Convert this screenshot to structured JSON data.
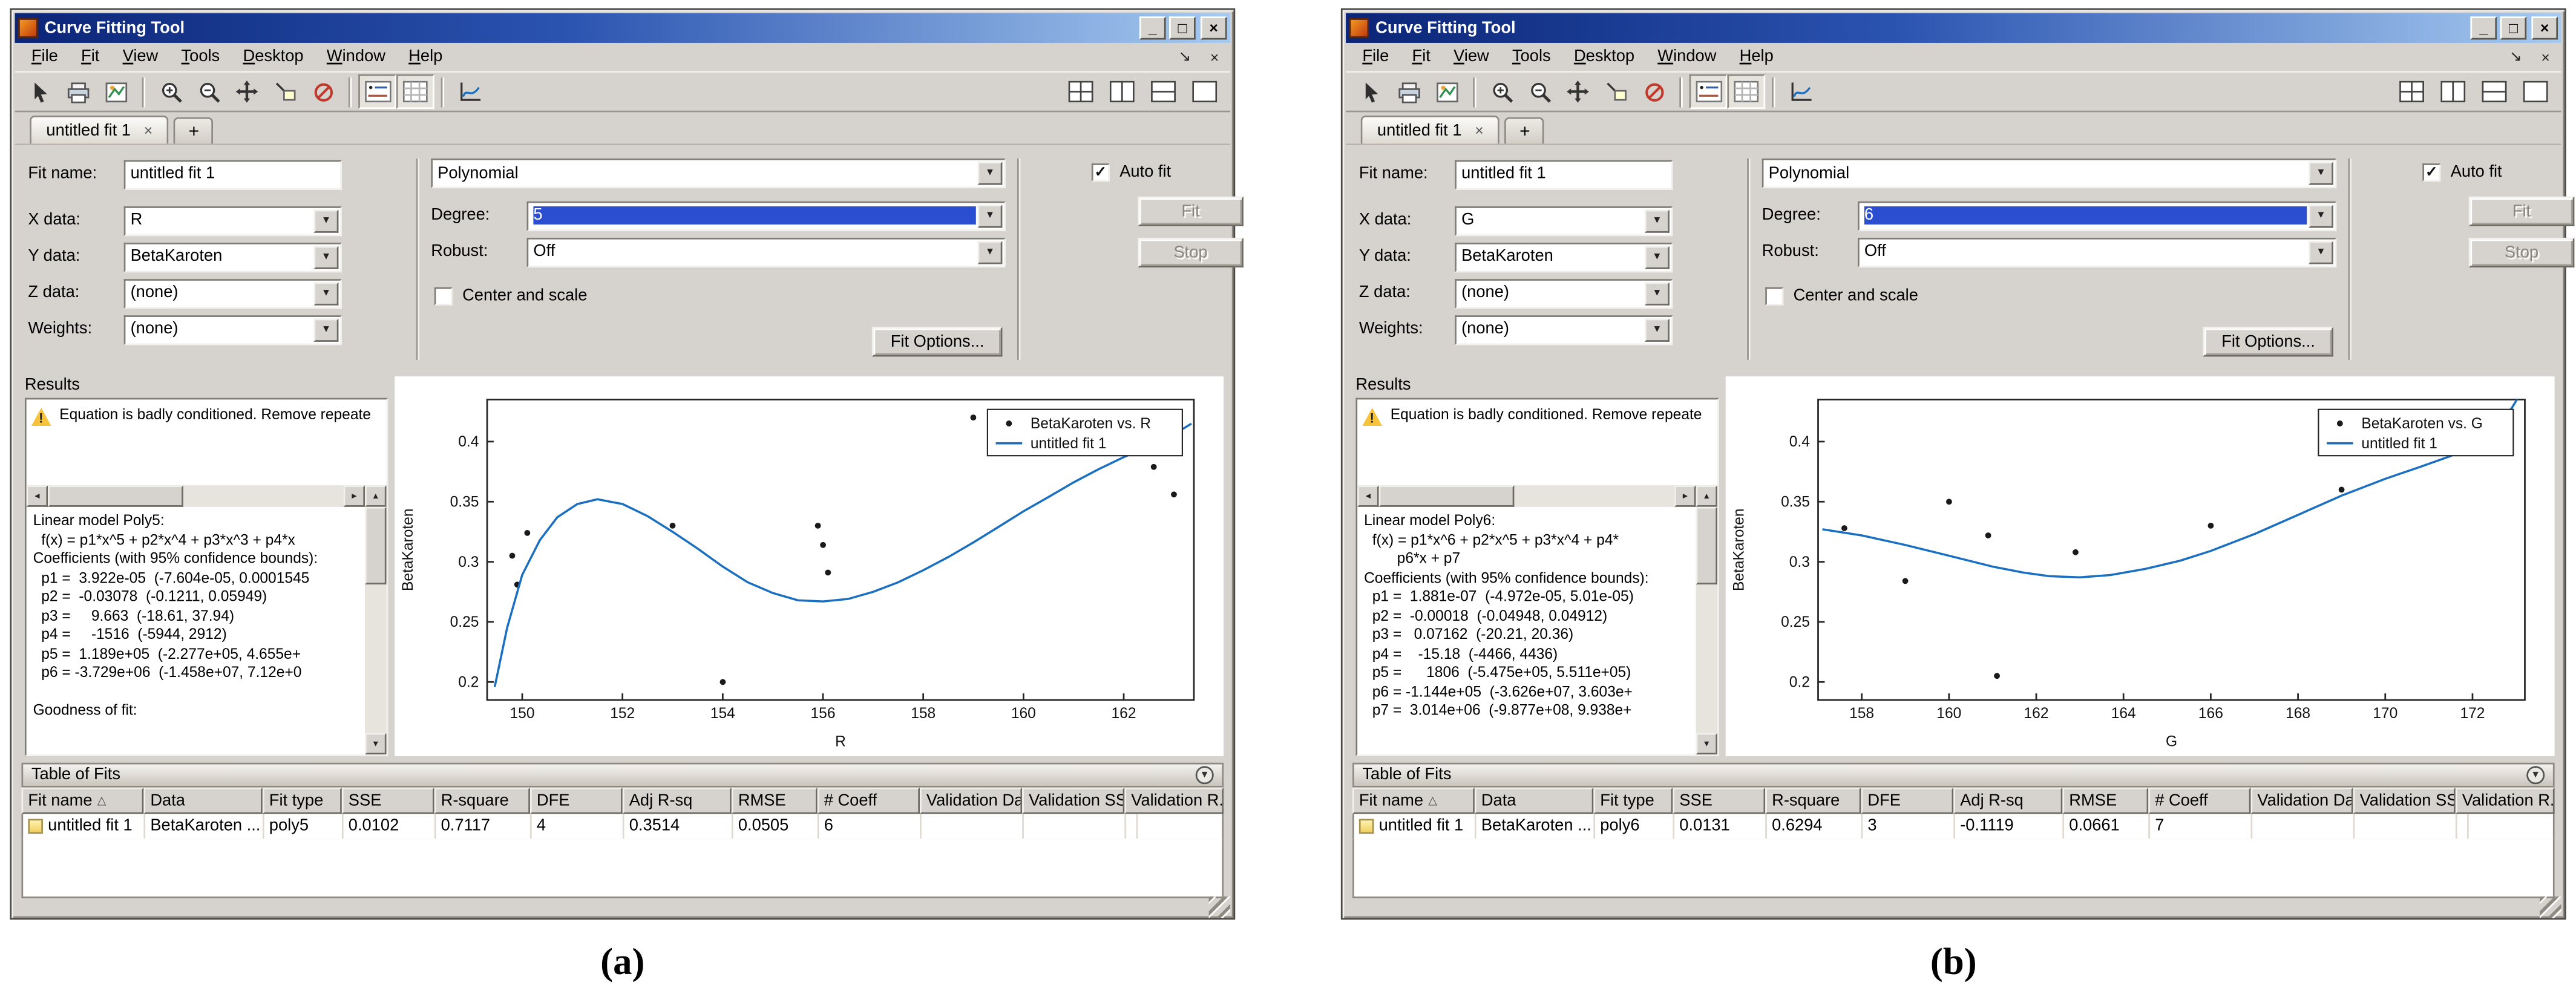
{
  "figure": {
    "label_a": "(a)",
    "label_b": "(b)"
  },
  "shared": {
    "colors": {
      "selection_blue": "#2b4ed0",
      "fit_line_blue": "#1a6fc0",
      "marker_black": "#1a1a1a",
      "warning_yellow": "#f6c33a"
    },
    "icons": {
      "minimize": "_",
      "maximize": "□",
      "close": "×",
      "dock": "↘",
      "chevron_down": "▼",
      "scroll_left": "◄",
      "scroll_right": "►",
      "scroll_up": "▲",
      "scroll_down": "▼",
      "sort_asc": "△",
      "collapse": "▾",
      "check": "✓",
      "new_tab": "+",
      "tab_close": "×"
    }
  },
  "windows": [
    {
      "title": "Curve Fitting Tool",
      "menu": [
        "File",
        "Fit",
        "View",
        "Tools",
        "Desktop",
        "Window",
        "Help"
      ],
      "tab": "untitled fit 1",
      "settings": {
        "fit_name_label": "Fit name:",
        "fit_name_value": "untitled fit 1",
        "x_label": "X data:",
        "x_value": "R",
        "y_label": "Y data:",
        "y_value": "BetaKaroten",
        "z_label": "Z data:",
        "z_value": "(none)",
        "weights_label": "Weights:",
        "weights_value": "(none)",
        "fit_type_value": "Polynomial",
        "degree_label": "Degree:",
        "degree_value": "5",
        "robust_label": "Robust:",
        "robust_value": "Off",
        "center_scale_label": "Center and scale",
        "fit_options_label": "Fit Options...",
        "auto_fit_label": "Auto fit",
        "fit_button": "Fit",
        "stop_button": "Stop"
      },
      "results": {
        "header": "Results",
        "warning": "Equation is badly conditioned. Remove repeate",
        "lines": [
          "Linear model Poly5:",
          "  f(x) = p1*x^5 + p2*x^4 + p3*x^3 + p4*x",
          "Coefficients (with 95% confidence bounds):",
          "  p1 =  3.922e-05  (-7.604e-05, 0.0001545",
          "  p2 =  -0.03078  (-0.1211, 0.05949)",
          "  p3 =     9.663  (-18.61, 37.94)",
          "  p4 =     -1516  (-5944, 2912)",
          "  p5 =  1.189e+05  (-2.277e+05, 4.655e+",
          "  p6 = -3.729e+06  (-1.458e+07, 7.12e+0",
          "",
          "Goodness of fit:"
        ]
      },
      "chart_data": {
        "type": "scatter",
        "title": "",
        "xlabel": "R",
        "ylabel": "BetaKaroten",
        "xlim": [
          149.3,
          163.4
        ],
        "ylim": [
          0.185,
          0.435
        ],
        "xticks": [
          150,
          152,
          154,
          156,
          158,
          160,
          162
        ],
        "yticks": [
          0.2,
          0.25,
          0.3,
          0.35,
          0.4
        ],
        "grid": false,
        "legend": [
          "BetaKaroten vs. R",
          "untitled fit 1"
        ],
        "legend_position": "top-right",
        "line_color": "#1a6fc0",
        "marker_color": "#1a1a1a",
        "series": [
          {
            "name": "BetaKaroten vs. R",
            "type": "scatter",
            "points": [
              [
                149.8,
                0.305
              ],
              [
                149.9,
                0.281
              ],
              [
                150.1,
                0.324
              ],
              [
                153.0,
                0.33
              ],
              [
                154.0,
                0.2
              ],
              [
                155.9,
                0.33
              ],
              [
                156.0,
                0.314
              ],
              [
                156.1,
                0.291
              ],
              [
                159.0,
                0.42
              ],
              [
                162.6,
                0.379
              ],
              [
                163.0,
                0.356
              ]
            ]
          },
          {
            "name": "untitled fit 1",
            "type": "line",
            "points": [
              [
                149.45,
                0.196
              ],
              [
                149.7,
                0.245
              ],
              [
                150.0,
                0.289
              ],
              [
                150.35,
                0.318
              ],
              [
                150.7,
                0.337
              ],
              [
                151.1,
                0.348
              ],
              [
                151.5,
                0.352
              ],
              [
                152.0,
                0.348
              ],
              [
                152.5,
                0.338
              ],
              [
                153.0,
                0.325
              ],
              [
                153.5,
                0.311
              ],
              [
                154.0,
                0.296
              ],
              [
                154.5,
                0.283
              ],
              [
                155.0,
                0.274
              ],
              [
                155.5,
                0.268
              ],
              [
                156.0,
                0.267
              ],
              [
                156.5,
                0.269
              ],
              [
                157.0,
                0.275
              ],
              [
                157.5,
                0.283
              ],
              [
                158.0,
                0.293
              ],
              [
                158.5,
                0.304
              ],
              [
                159.0,
                0.316
              ],
              [
                159.5,
                0.329
              ],
              [
                160.0,
                0.342
              ],
              [
                160.5,
                0.354
              ],
              [
                161.0,
                0.366
              ],
              [
                161.5,
                0.377
              ],
              [
                162.0,
                0.387
              ],
              [
                162.5,
                0.396
              ],
              [
                163.0,
                0.406
              ],
              [
                163.35,
                0.415
              ]
            ]
          }
        ]
      },
      "table": {
        "header": "Table of Fits",
        "columns": [
          "Fit name",
          "Data",
          "Fit type",
          "SSE",
          "R-square",
          "DFE",
          "Adj R-sq",
          "RMSE",
          "# Coeff",
          "Validation Data",
          "Validation SSE",
          "Validation R..."
        ],
        "rows": [
          [
            "untitled fit 1",
            "BetaKaroten ...",
            "poly5",
            "0.0102",
            "0.7117",
            "4",
            "0.3514",
            "0.0505",
            "6",
            "",
            "",
            ""
          ]
        ]
      }
    },
    {
      "title": "Curve Fitting Tool",
      "menu": [
        "File",
        "Fit",
        "View",
        "Tools",
        "Desktop",
        "Window",
        "Help"
      ],
      "tab": "untitled fit 1",
      "settings": {
        "fit_name_label": "Fit name:",
        "fit_name_value": "untitled fit 1",
        "x_label": "X data:",
        "x_value": "G",
        "y_label": "Y data:",
        "y_value": "BetaKaroten",
        "z_label": "Z data:",
        "z_value": "(none)",
        "weights_label": "Weights:",
        "weights_value": "(none)",
        "fit_type_value": "Polynomial",
        "degree_label": "Degree:",
        "degree_value": "6",
        "robust_label": "Robust:",
        "robust_value": "Off",
        "center_scale_label": "Center and scale",
        "fit_options_label": "Fit Options...",
        "auto_fit_label": "Auto fit",
        "fit_button": "Fit",
        "stop_button": "Stop"
      },
      "results": {
        "header": "Results",
        "warning": "Equation is badly conditioned. Remove repeate",
        "lines": [
          "Linear model Poly6:",
          "  f(x) = p1*x^6 + p2*x^5 + p3*x^4 + p4*",
          "        p6*x + p7",
          "Coefficients (with 95% confidence bounds):",
          "  p1 =  1.881e-07  (-4.972e-05, 5.01e-05)",
          "  p2 =  -0.00018  (-0.04948, 0.04912)",
          "  p3 =   0.07162  (-20.21, 20.36)",
          "  p4 =    -15.18  (-4466, 4436)",
          "  p5 =      1806  (-5.475e+05, 5.511e+05)",
          "  p6 = -1.144e+05  (-3.626e+07, 3.603e+",
          "  p7 =  3.014e+06  (-9.877e+08, 9.938e+"
        ]
      },
      "chart_data": {
        "type": "scatter",
        "title": "",
        "xlabel": "G",
        "ylabel": "BetaKaroten",
        "xlim": [
          157.0,
          173.2
        ],
        "ylim": [
          0.185,
          0.435
        ],
        "xticks": [
          158,
          160,
          162,
          164,
          166,
          168,
          170,
          172
        ],
        "yticks": [
          0.2,
          0.25,
          0.3,
          0.35,
          0.4
        ],
        "grid": false,
        "legend": [
          "BetaKaroten vs. G",
          "untitled fit 1"
        ],
        "legend_position": "top-right",
        "line_color": "#1a6fc0",
        "marker_color": "#1a1a1a",
        "series": [
          {
            "name": "BetaKaroten vs. G",
            "type": "scatter",
            "points": [
              [
                157.6,
                0.328
              ],
              [
                159.0,
                0.284
              ],
              [
                160.0,
                0.35
              ],
              [
                160.9,
                0.322
              ],
              [
                161.1,
                0.205
              ],
              [
                162.9,
                0.308
              ],
              [
                166.0,
                0.33
              ],
              [
                169.0,
                0.36
              ]
            ]
          },
          {
            "name": "untitled fit 1",
            "type": "line",
            "points": [
              [
                157.1,
                0.327
              ],
              [
                158.0,
                0.322
              ],
              [
                159.0,
                0.314
              ],
              [
                160.0,
                0.305
              ],
              [
                161.0,
                0.296
              ],
              [
                161.7,
                0.291
              ],
              [
                162.3,
                0.288
              ],
              [
                163.0,
                0.287
              ],
              [
                163.7,
                0.289
              ],
              [
                164.5,
                0.294
              ],
              [
                165.3,
                0.301
              ],
              [
                166.0,
                0.309
              ],
              [
                167.0,
                0.323
              ],
              [
                168.0,
                0.339
              ],
              [
                169.0,
                0.355
              ],
              [
                170.0,
                0.369
              ],
              [
                170.8,
                0.379
              ],
              [
                171.5,
                0.388
              ],
              [
                172.0,
                0.397
              ],
              [
                172.5,
                0.41
              ],
              [
                172.9,
                0.428
              ],
              [
                173.1,
                0.44
              ]
            ]
          }
        ]
      },
      "table": {
        "header": "Table of Fits",
        "columns": [
          "Fit name",
          "Data",
          "Fit type",
          "SSE",
          "R-square",
          "DFE",
          "Adj R-sq",
          "RMSE",
          "# Coeff",
          "Validation Data",
          "Validation SSE",
          "Validation R..."
        ],
        "rows": [
          [
            "untitled fit 1",
            "BetaKaroten ...",
            "poly6",
            "0.0131",
            "0.6294",
            "3",
            "-0.1119",
            "0.0661",
            "7",
            "",
            "",
            ""
          ]
        ]
      }
    }
  ]
}
